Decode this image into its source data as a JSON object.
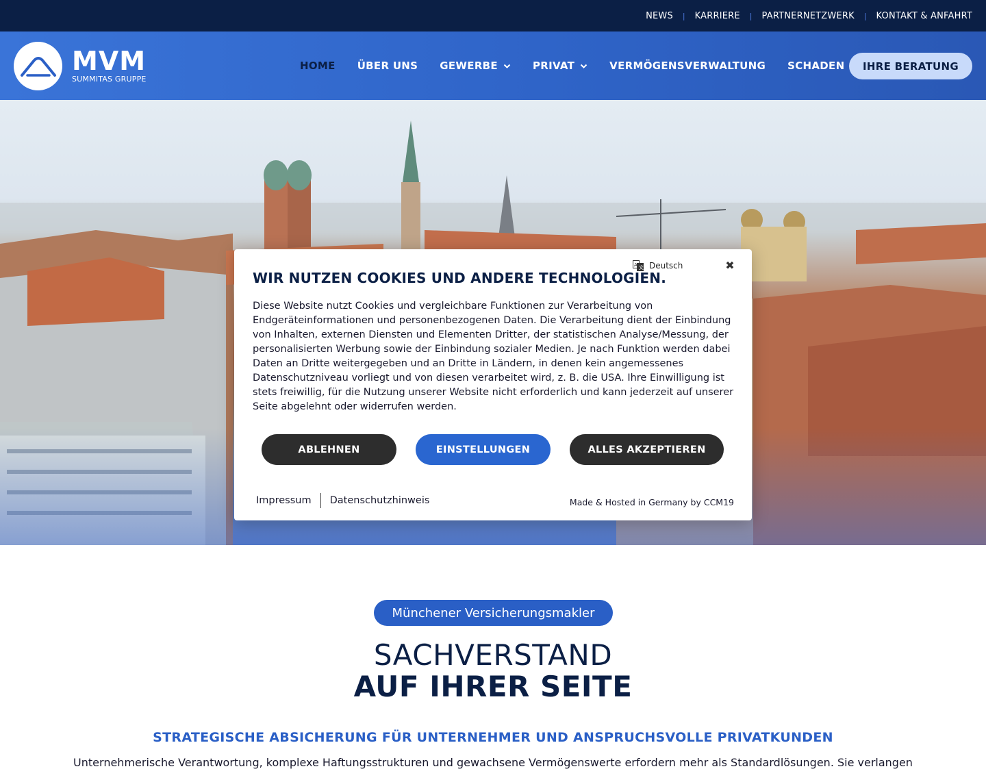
{
  "topbar": {
    "links": [
      "NEWS",
      "KARRIERE",
      "PARTNERNETZWERK",
      "KONTAKT & ANFAHRT"
    ]
  },
  "header": {
    "logo_title": "MVM",
    "logo_subtitle": "SUMMITAS GRUPPE",
    "nav": [
      "HOME",
      "ÜBER UNS",
      "GEWERBE",
      "PRIVAT",
      "VERMÖGENSVERWALTUNG",
      "SCHADEN"
    ],
    "active_nav": "HOME",
    "cta_label": "IHRE BERATUNG"
  },
  "cookie_banner": {
    "title": "WIR NUTZEN COOKIES UND ANDERE TECHNOLOGIEN.",
    "language": "Deutsch",
    "text": "Diese Website nutzt Cookies und vergleichbare Funktionen zur Verarbeitung von Endgeräteinformationen und personenbezogenen Daten. Die Verarbeitung dient der Einbindung von Inhalten, externen Diensten und Elementen Dritter, der statistischen Analyse/Messung, der personalisierten Werbung sowie der Einbindung sozialer Medien. Je nach Funktion werden dabei Daten an Dritte weitergegeben und an Dritte in Ländern, in denen kein angemessenes Datenschutzniveau vorliegt und von diesen verarbeitet wird, z. B. die USA. Ihre Einwilligung ist stets freiwillig, für die Nutzung unserer Website nicht erforderlich und kann jederzeit auf unserer Seite abgelehnt oder widerrufen werden.",
    "buttons": {
      "reject": "ABLEHNEN",
      "settings": "EINSTELLUNGEN",
      "accept_all": "ALLES AKZEPTIEREN"
    },
    "footer_links": [
      "Impressum",
      "Datenschutzhinweis"
    ],
    "hosted_note": "Made & Hosted in Germany by CCM19"
  },
  "intro": {
    "pill": "Münchener Versicherungsmakler",
    "headline_line1": "SACHVERSTAND",
    "headline_line2": "AUF IHRER SEITE",
    "subheadline": "STRATEGISCHE ABSICHERUNG FÜR UNTERNEHMER UND ANSPRUCHSVOLLE PRIVATKUNDEN",
    "body": "Unternehmerische Verantwortung, komplexe Haftungsstrukturen und gewachsene Vermögenswerte erfordern mehr als Standardlösungen. Sie verlangen"
  },
  "colors": {
    "topbar_bg": "#0b1f45",
    "header_bg": "#3a74d8",
    "accent": "#2a5fc6",
    "cta_bg": "#c8dafa",
    "dark_button": "#2d2d2d"
  }
}
